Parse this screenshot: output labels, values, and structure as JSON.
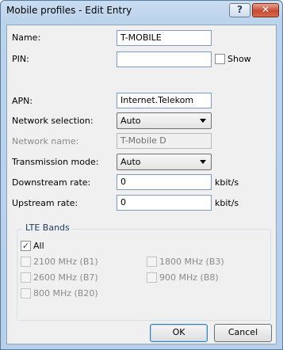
{
  "window": {
    "title": "Mobile profiles - Edit Entry"
  },
  "titlebar": {
    "help_glyph": "?",
    "close_glyph": "✕"
  },
  "fields": {
    "name": {
      "label": "Name:",
      "value": "T-MOBILE"
    },
    "pin": {
      "label": "PIN:",
      "value": "",
      "show_label": "Show",
      "show_checked": false
    },
    "apn": {
      "label": "APN:",
      "value": "Internet.Telekom"
    },
    "network_selection": {
      "label": "Network selection:",
      "value": "Auto"
    },
    "network_name": {
      "label": "Network name:",
      "value": "T-Mobile D",
      "disabled": true
    },
    "transmission_mode": {
      "label": "Transmission mode:",
      "value": "Auto"
    },
    "downstream_rate": {
      "label": "Downstream rate:",
      "value": "0",
      "unit": "kbit/s"
    },
    "upstream_rate": {
      "label": "Upstream rate:",
      "value": "0",
      "unit": "kbit/s"
    }
  },
  "lte_bands": {
    "title": "LTE Bands",
    "all": {
      "label": "All",
      "checked": true
    },
    "bands": [
      {
        "label": "2100 MHz (B1)",
        "checked": false,
        "disabled": true
      },
      {
        "label": "1800 MHz (B3)",
        "checked": false,
        "disabled": true
      },
      {
        "label": "2600 MHz (B7)",
        "checked": false,
        "disabled": true
      },
      {
        "label": "900 MHz (B8)",
        "checked": false,
        "disabled": true
      },
      {
        "label": "800 MHz (B20)",
        "checked": false,
        "disabled": true
      }
    ]
  },
  "buttons": {
    "ok": "OK",
    "cancel": "Cancel"
  },
  "colors": {
    "titlebar": "#c9ddf1",
    "close_button": "#c44b31",
    "dialog_bg": "#f0f0f0",
    "disabled_text": "#8a8a8a"
  }
}
